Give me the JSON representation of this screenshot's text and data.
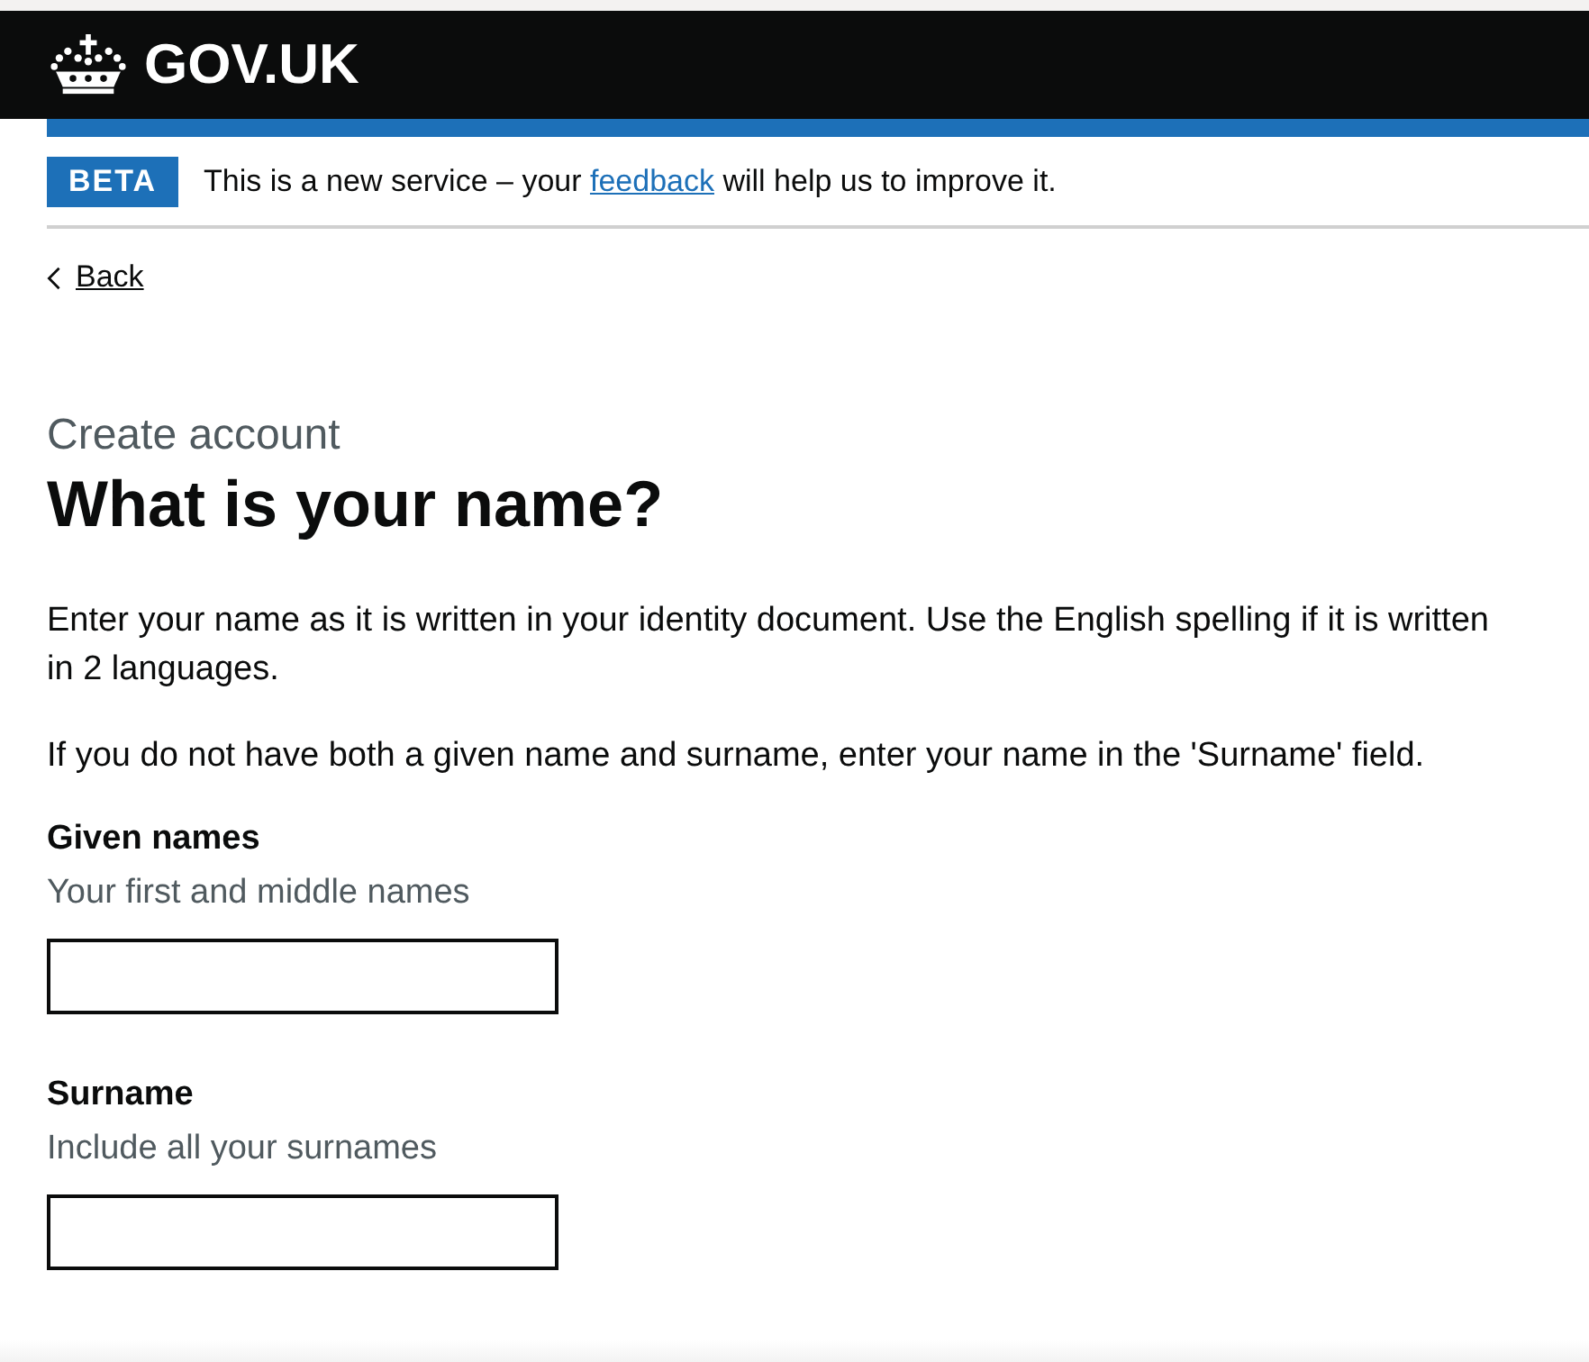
{
  "header": {
    "logo": "GOV.UK"
  },
  "phase_banner": {
    "tag": "BETA",
    "text_before": "This is a new service – your",
    "link": "feedback",
    "text_after": "will help us to improve it."
  },
  "back_link": "Back",
  "caption": "Create account",
  "heading": "What is your name?",
  "paragraphs": [
    "Enter your name as it is written in your identity document. Use the English spelling if it is written in 2 languages.",
    "If you do not have both a given name and surname, enter your name in the 'Surname' field."
  ],
  "fields": [
    {
      "label": "Given names",
      "hint": "Your first and middle names"
    },
    {
      "label": "Surname",
      "hint": "Include all your surnames"
    }
  ]
}
